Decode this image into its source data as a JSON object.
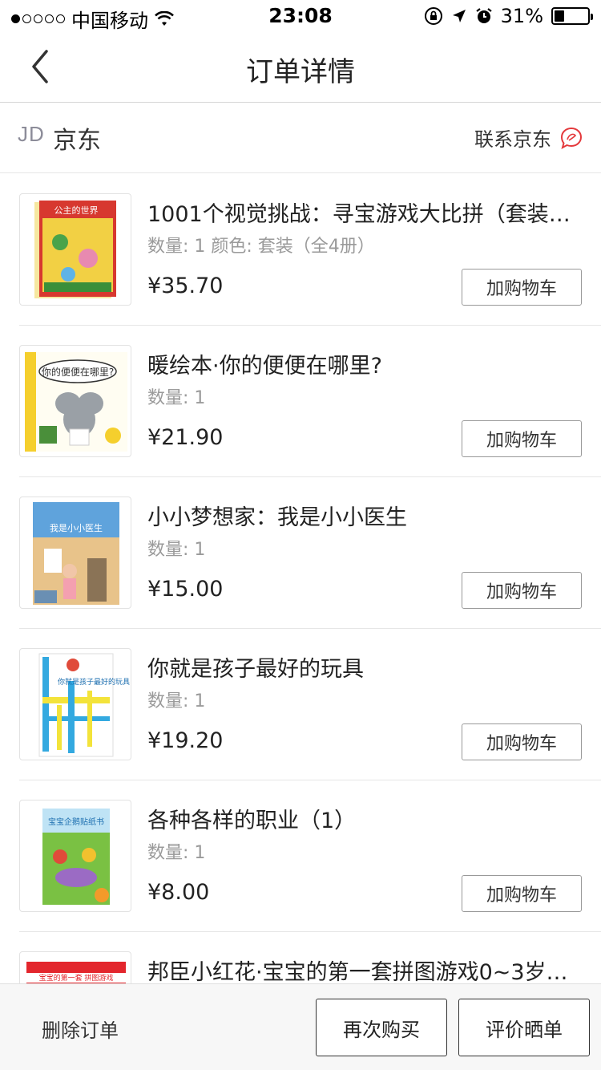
{
  "status_bar": {
    "carrier": "中国移动",
    "time": "23:08",
    "battery": "31%",
    "battery_level": 0.31
  },
  "nav": {
    "title": "订单详情"
  },
  "shop": {
    "logo": "JD",
    "name": "京东",
    "contact_label": "联系京东"
  },
  "items": [
    {
      "title": "1001个视觉挑战：寻宝游戏大比拼（套装…",
      "meta": "数量: 1 颜色: 套装（全4册）",
      "price": "¥35.70",
      "action": "加购物车",
      "cover_text": "公主的世界",
      "cover_colors": [
        "#d7382f",
        "#f2d044",
        "#4aa34a"
      ]
    },
    {
      "title": "暖绘本·你的便便在哪里?",
      "meta": "数量: 1",
      "price": "¥21.90",
      "action": "加购物车",
      "cover_text": "你的便便在哪里?",
      "cover_colors": [
        "#f5cf2d",
        "#9aa0a6",
        "#fff"
      ]
    },
    {
      "title": "小小梦想家：我是小小医生",
      "meta": "数量: 1",
      "price": "¥15.00",
      "action": "加购物车",
      "cover_text": "我是小小医生",
      "cover_colors": [
        "#5fa3dc",
        "#e8c38a",
        "#c6d9ea"
      ]
    },
    {
      "title": "你就是孩子最好的玩具",
      "meta": "数量: 1",
      "price": "¥19.20",
      "action": "加购物车",
      "cover_text": "你就是孩子最好的玩具",
      "cover_colors": [
        "#33a9e0",
        "#f3e33a",
        "#fff"
      ]
    },
    {
      "title": "各种各样的职业（1）",
      "meta": "数量: 1",
      "price": "¥8.00",
      "action": "加购物车",
      "cover_text": "宝宝企鹅贴纸书",
      "cover_colors": [
        "#7ac143",
        "#e04b3a",
        "#9b6bc4"
      ]
    },
    {
      "title": "邦臣小红花·宝宝的第一套拼图游戏0~3岁…",
      "meta": "",
      "price": "",
      "action": "",
      "cover_text": "宝宝的第一套 拼图游戏",
      "cover_colors": [
        "#e3262d",
        "#ffffff",
        "#f2c12e"
      ]
    }
  ],
  "footer": {
    "delete_label": "删除订单",
    "rebuy_label": "再次购买",
    "review_label": "评价晒单"
  }
}
